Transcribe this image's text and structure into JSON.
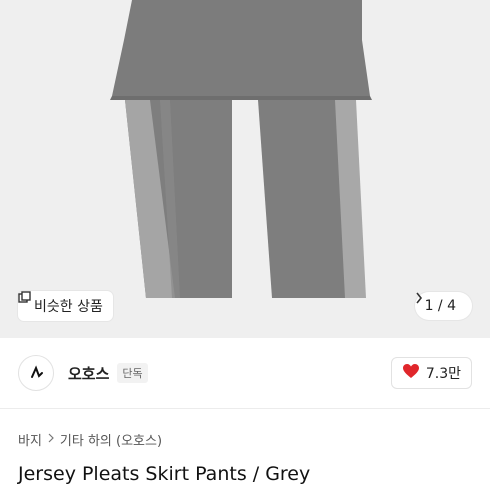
{
  "product_image": {
    "similar_label": "비슷한 상품",
    "pager": "1 / 4"
  },
  "seller": {
    "name": "오호스",
    "badge": "단독",
    "likes": "7.3만"
  },
  "breadcrumb": {
    "level1": "바지",
    "level2": "기타 하의 (오호스)"
  },
  "product": {
    "title": "Jersey Pleats Skirt Pants / Grey"
  },
  "colors": {
    "heart": "#e0262b"
  }
}
